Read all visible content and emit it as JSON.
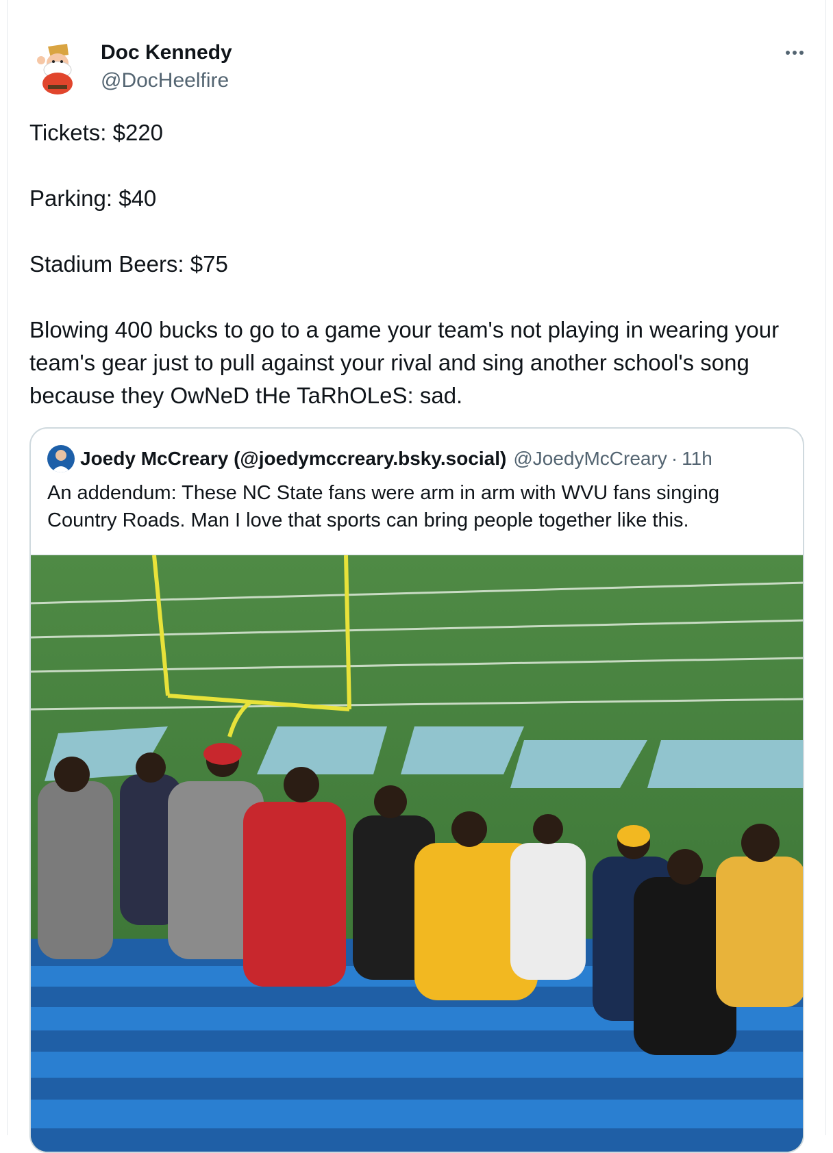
{
  "tweet": {
    "author_name": "Doc Kennedy",
    "author_handle": "@DocHeelfire",
    "more_icon": "more-horizontal-icon",
    "lines": [
      "Tickets: $220",
      "",
      "Parking: $40",
      "",
      "Stadium Beers: $75",
      "",
      "Blowing 400 bucks to go to a game your team's not playing in wearing your team's gear just to pull against your rival and sing another school's song because they OwNeD tHe TaRhOLeS: sad."
    ]
  },
  "quote": {
    "author_name": "Joedy McCreary (@joedymccreary.bsky.social)",
    "author_handle": "@JoedyMcCreary",
    "separator": "·",
    "time": "11h",
    "text": "An addendum: These NC State fans were arm in arm with WVU fans singing Country Roads. Man I love that sports can bring people together like this."
  },
  "colors": {
    "text_primary": "#0f1419",
    "text_secondary": "#536471",
    "border": "#cfd9de",
    "field_green": "#3f7f3a",
    "seat_blue": "#2a7fd1",
    "goalpost_yellow": "#e8e23a"
  }
}
